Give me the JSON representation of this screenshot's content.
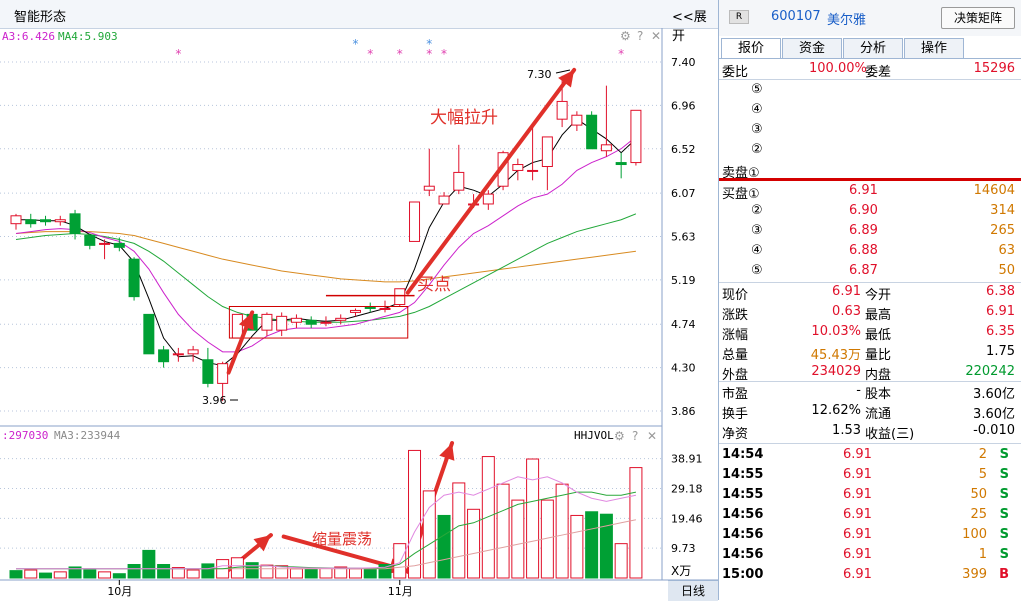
{
  "window": {
    "title": "智能形态",
    "expand_label": "<<展开"
  },
  "ma_labels": {
    "ma3": "A3:6.426",
    "ma4": "MA4:5.903",
    "vol1": ":297030",
    "vol2": "MA3:233944",
    "vol_name": "HHJVOL"
  },
  "annotations": {
    "surge": "大幅拉升",
    "buy": "买点",
    "shrink": "缩量震荡",
    "high_label": "7.30",
    "low_label": "3.96"
  },
  "colors": {
    "up": "#e0102a",
    "down": "#00a034",
    "ma_black": "#000000",
    "ma_magenta": "#cc22cc",
    "ma_green": "#22a83a",
    "ma_orange": "#d88a20",
    "vol_pink": "#e088e0",
    "vol_green": "#2aa83a"
  },
  "chart_data": [
    {
      "type": "candlestick",
      "title": "",
      "y_ticks": [
        "7.40",
        "6.96",
        "6.52",
        "6.07",
        "5.63",
        "5.19",
        "4.74",
        "4.30",
        "3.86"
      ],
      "x_ticks": [
        "10月",
        "11月"
      ],
      "ylim": [
        3.86,
        7.4
      ],
      "candles": [
        {
          "o": 5.76,
          "h": 5.86,
          "l": 5.7,
          "c": 5.84
        },
        {
          "o": 5.8,
          "h": 5.86,
          "l": 5.72,
          "c": 5.76
        },
        {
          "o": 5.8,
          "h": 5.84,
          "l": 5.74,
          "c": 5.78
        },
        {
          "o": 5.78,
          "h": 5.84,
          "l": 5.74,
          "c": 5.8
        },
        {
          "o": 5.86,
          "h": 5.9,
          "l": 5.6,
          "c": 5.66
        },
        {
          "o": 5.64,
          "h": 5.66,
          "l": 5.5,
          "c": 5.54
        },
        {
          "o": 5.56,
          "h": 5.6,
          "l": 5.4,
          "c": 5.56
        },
        {
          "o": 5.56,
          "h": 5.62,
          "l": 5.48,
          "c": 5.52
        },
        {
          "o": 5.4,
          "h": 5.42,
          "l": 4.98,
          "c": 5.02
        },
        {
          "o": 4.84,
          "h": 4.84,
          "l": 4.44,
          "c": 4.44
        },
        {
          "o": 4.48,
          "h": 4.52,
          "l": 4.3,
          "c": 4.36
        },
        {
          "o": 4.44,
          "h": 4.5,
          "l": 4.36,
          "c": 4.44
        },
        {
          "o": 4.44,
          "h": 4.52,
          "l": 4.36,
          "c": 4.48
        },
        {
          "o": 4.38,
          "h": 4.5,
          "l": 4.1,
          "c": 4.14
        },
        {
          "o": 4.14,
          "h": 4.36,
          "l": 3.96,
          "c": 4.34
        },
        {
          "o": 4.6,
          "h": 4.84,
          "l": 4.6,
          "c": 4.84
        },
        {
          "o": 4.84,
          "h": 4.88,
          "l": 4.68,
          "c": 4.68
        },
        {
          "o": 4.68,
          "h": 4.86,
          "l": 4.62,
          "c": 4.84
        },
        {
          "o": 4.68,
          "h": 4.86,
          "l": 4.62,
          "c": 4.82
        },
        {
          "o": 4.76,
          "h": 4.84,
          "l": 4.7,
          "c": 4.8
        },
        {
          "o": 4.78,
          "h": 4.82,
          "l": 4.7,
          "c": 4.74
        },
        {
          "o": 4.76,
          "h": 4.82,
          "l": 4.72,
          "c": 4.76
        },
        {
          "o": 4.78,
          "h": 4.84,
          "l": 4.74,
          "c": 4.8
        },
        {
          "o": 4.86,
          "h": 4.9,
          "l": 4.82,
          "c": 4.88
        },
        {
          "o": 4.92,
          "h": 4.96,
          "l": 4.86,
          "c": 4.9
        },
        {
          "o": 4.9,
          "h": 4.98,
          "l": 4.86,
          "c": 4.9
        },
        {
          "o": 4.94,
          "h": 5.1,
          "l": 4.92,
          "c": 5.1
        },
        {
          "o": 5.58,
          "h": 5.98,
          "l": 5.58,
          "c": 5.98
        },
        {
          "o": 6.1,
          "h": 6.52,
          "l": 6.04,
          "c": 6.14
        },
        {
          "o": 5.96,
          "h": 6.08,
          "l": 5.96,
          "c": 6.04
        },
        {
          "o": 6.1,
          "h": 6.56,
          "l": 6.06,
          "c": 6.28
        },
        {
          "o": 5.96,
          "h": 6.06,
          "l": 5.92,
          "c": 5.96
        },
        {
          "o": 5.96,
          "h": 6.1,
          "l": 5.9,
          "c": 6.06
        },
        {
          "o": 6.14,
          "h": 6.5,
          "l": 6.1,
          "c": 6.48
        },
        {
          "o": 6.3,
          "h": 6.42,
          "l": 6.2,
          "c": 6.36
        },
        {
          "o": 6.3,
          "h": 6.76,
          "l": 6.2,
          "c": 6.3
        },
        {
          "o": 6.34,
          "h": 6.64,
          "l": 6.1,
          "c": 6.64
        },
        {
          "o": 6.82,
          "h": 7.26,
          "l": 6.74,
          "c": 7.0
        },
        {
          "o": 6.76,
          "h": 6.9,
          "l": 6.7,
          "c": 6.86
        },
        {
          "o": 6.86,
          "h": 6.9,
          "l": 6.52,
          "c": 6.52
        },
        {
          "o": 6.5,
          "h": 7.16,
          "l": 6.44,
          "c": 6.56
        },
        {
          "o": 6.38,
          "h": 6.48,
          "l": 6.22,
          "c": 6.36
        },
        {
          "o": 6.38,
          "h": 6.91,
          "l": 6.35,
          "c": 6.91
        }
      ],
      "ma_black": [
        5.8,
        5.8,
        5.79,
        5.79,
        5.74,
        5.65,
        5.58,
        5.54,
        5.37,
        5.0,
        4.6,
        4.41,
        4.42,
        4.35,
        4.32,
        4.44,
        4.62,
        4.78,
        4.78,
        4.8,
        4.78,
        4.77,
        4.78,
        4.82,
        4.86,
        4.9,
        4.96,
        5.3,
        5.72,
        5.98,
        6.14,
        6.1,
        6.04,
        6.16,
        6.3,
        6.38,
        6.42,
        6.66,
        6.82,
        6.72,
        6.62,
        6.48,
        6.62
      ],
      "ma_magenta": [
        5.66,
        5.68,
        5.7,
        5.71,
        5.7,
        5.67,
        5.62,
        5.58,
        5.48,
        5.3,
        5.06,
        4.84,
        4.68,
        4.56,
        4.46,
        4.46,
        4.52,
        4.62,
        4.68,
        4.7,
        4.7,
        4.7,
        4.72,
        4.74,
        4.78,
        4.82,
        4.86,
        4.96,
        5.14,
        5.34,
        5.52,
        5.66,
        5.74,
        5.84,
        5.94,
        6.02,
        6.06,
        6.16,
        6.3,
        6.38,
        6.44,
        6.52,
        6.64
      ],
      "ma_green": [
        5.6,
        5.62,
        5.64,
        5.65,
        5.66,
        5.65,
        5.63,
        5.6,
        5.56,
        5.48,
        5.38,
        5.26,
        5.14,
        5.02,
        4.92,
        4.86,
        4.82,
        4.8,
        4.78,
        4.77,
        4.76,
        4.76,
        4.76,
        4.77,
        4.78,
        4.8,
        4.82,
        4.86,
        4.92,
        5.0,
        5.08,
        5.16,
        5.24,
        5.32,
        5.4,
        5.48,
        5.56,
        5.62,
        5.68,
        5.72,
        5.76,
        5.8,
        5.86
      ],
      "ma_orange": [
        5.66,
        5.67,
        5.68,
        5.68,
        5.68,
        5.68,
        5.67,
        5.66,
        5.64,
        5.6,
        5.56,
        5.52,
        5.48,
        5.44,
        5.4,
        5.37,
        5.34,
        5.31,
        5.28,
        5.26,
        5.24,
        5.22,
        5.2,
        5.19,
        5.18,
        5.17,
        5.17,
        5.18,
        5.2,
        5.22,
        5.24,
        5.26,
        5.28,
        5.3,
        5.32,
        5.34,
        5.36,
        5.38,
        5.4,
        5.42,
        5.44,
        5.46,
        5.48
      ]
    },
    {
      "type": "bar",
      "title": "",
      "y_ticks": [
        "38.91",
        "29.18",
        "19.46",
        "9.73"
      ],
      "ylim": [
        0,
        45
      ],
      "unit": "X万",
      "volumes": [
        {
          "v": 2.4,
          "u": false
        },
        {
          "v": 2.6,
          "u": true
        },
        {
          "v": 1.6,
          "u": false
        },
        {
          "v": 2.0,
          "u": true
        },
        {
          "v": 3.6,
          "u": false
        },
        {
          "v": 2.6,
          "u": false
        },
        {
          "v": 2.0,
          "u": true
        },
        {
          "v": 1.4,
          "u": false
        },
        {
          "v": 4.4,
          "u": false
        },
        {
          "v": 9.0,
          "u": false
        },
        {
          "v": 4.4,
          "u": false
        },
        {
          "v": 3.4,
          "u": true
        },
        {
          "v": 2.6,
          "u": true
        },
        {
          "v": 4.6,
          "u": false
        },
        {
          "v": 6.0,
          "u": true
        },
        {
          "v": 6.6,
          "u": true
        },
        {
          "v": 5.0,
          "u": false
        },
        {
          "v": 4.2,
          "u": true
        },
        {
          "v": 4.0,
          "u": true
        },
        {
          "v": 3.0,
          "u": true
        },
        {
          "v": 2.8,
          "u": false
        },
        {
          "v": 3.2,
          "u": true
        },
        {
          "v": 3.6,
          "u": true
        },
        {
          "v": 3.0,
          "u": true
        },
        {
          "v": 3.0,
          "u": false
        },
        {
          "v": 4.4,
          "u": false
        },
        {
          "v": 11.2,
          "u": true
        },
        {
          "v": 41.6,
          "u": true
        },
        {
          "v": 28.4,
          "u": true
        },
        {
          "v": 20.4,
          "u": false
        },
        {
          "v": 31.0,
          "u": true
        },
        {
          "v": 22.4,
          "u": true
        },
        {
          "v": 39.6,
          "u": true
        },
        {
          "v": 30.6,
          "u": true
        },
        {
          "v": 25.4,
          "u": true
        },
        {
          "v": 38.8,
          "u": true
        },
        {
          "v": 25.4,
          "u": true
        },
        {
          "v": 30.6,
          "u": true
        },
        {
          "v": 20.4,
          "u": true
        },
        {
          "v": 21.6,
          "u": false
        },
        {
          "v": 20.8,
          "u": false
        },
        {
          "v": 11.2,
          "u": true
        },
        {
          "v": 36.0,
          "u": true
        }
      ],
      "vol_ma_pink": [
        3,
        3,
        3,
        3,
        3,
        3,
        3,
        3,
        3,
        3,
        3,
        3,
        3,
        3,
        4,
        4,
        4,
        4,
        3.6,
        3.4,
        3.2,
        3.2,
        3.2,
        3.2,
        3.3,
        3.5,
        5,
        15,
        23,
        27,
        28,
        27,
        29,
        31,
        33,
        32,
        33,
        31,
        28,
        26,
        25,
        26,
        27
      ],
      "vol_ma_green": [
        3,
        3,
        3,
        3,
        3,
        3,
        3,
        3,
        3,
        3,
        3,
        3,
        3,
        3,
        3,
        3.5,
        3.8,
        4,
        3.8,
        3.6,
        3.4,
        3.3,
        3.2,
        3.2,
        3.2,
        3.3,
        4.5,
        8,
        11,
        14,
        17,
        18,
        20,
        22,
        24,
        25,
        26,
        27,
        28,
        28,
        27,
        27,
        28
      ],
      "vol_ma_pinklong": [
        3,
        3,
        3,
        3,
        3,
        3,
        3,
        3,
        3,
        3,
        3,
        3,
        3,
        3,
        3,
        3,
        3,
        3,
        3,
        3,
        3,
        3,
        3,
        3,
        3,
        3,
        3.5,
        4,
        5,
        6,
        7,
        8,
        9,
        10,
        11,
        12,
        13,
        14,
        15,
        16,
        17,
        18,
        19
      ]
    }
  ],
  "quote": {
    "code": "600107",
    "name": "美尔雅",
    "badge": "R",
    "decision_btn": "决策矩阵",
    "tabs": [
      "报价",
      "资金",
      "分析",
      "操作"
    ],
    "weibi_label": "委比",
    "weibi_value": "100.00%",
    "weicha_label": "委差",
    "weicha_value": "15296",
    "sell_rows": [
      {
        "label": "⑤",
        "price": "",
        "vol": ""
      },
      {
        "label": "④",
        "price": "",
        "vol": ""
      },
      {
        "label": "③",
        "price": "",
        "vol": ""
      },
      {
        "label": "②",
        "price": "",
        "vol": ""
      },
      {
        "label": "卖盘①",
        "price": "",
        "vol": ""
      }
    ],
    "buy_rows": [
      {
        "label": "买盘①",
        "price": "6.91",
        "vol": "14604"
      },
      {
        "label": "②",
        "price": "6.90",
        "vol": "314"
      },
      {
        "label": "③",
        "price": "6.89",
        "vol": "265"
      },
      {
        "label": "④",
        "price": "6.88",
        "vol": "63"
      },
      {
        "label": "⑤",
        "price": "6.87",
        "vol": "50"
      }
    ],
    "stats1": [
      {
        "l1": "现价",
        "v1": "6.91",
        "c1": "red",
        "l2": "今开",
        "v2": "6.38",
        "c2": "red"
      },
      {
        "l1": "涨跌",
        "v1": "0.63",
        "c1": "red",
        "l2": "最高",
        "v2": "6.91",
        "c2": "red"
      },
      {
        "l1": "涨幅",
        "v1": "10.03%",
        "c1": "red",
        "l2": "最低",
        "v2": "6.35",
        "c2": "red"
      },
      {
        "l1": "总量",
        "v1": "45.43万",
        "c1": "orange",
        "l2": "量比",
        "v2": "1.75",
        "c2": "black"
      },
      {
        "l1": "外盘",
        "v1": "234029",
        "c1": "red",
        "l2": "内盘",
        "v2": "220242",
        "c2": "green"
      }
    ],
    "stats2": [
      {
        "l1": "市盈",
        "v1": "-",
        "c1": "black",
        "l2": "股本",
        "v2": "3.60亿",
        "c2": "black"
      },
      {
        "l1": "换手",
        "v1": "12.62%",
        "c1": "black",
        "l2": "流通",
        "v2": "3.60亿",
        "c2": "black"
      },
      {
        "l1": "净资",
        "v1": "1.53",
        "c1": "black",
        "l2": "收益(三)",
        "v2": "-0.010",
        "c2": "black"
      }
    ],
    "ticks": [
      {
        "time": "14:54",
        "price": "6.91",
        "vol": "2",
        "side": "S"
      },
      {
        "time": "14:55",
        "price": "6.91",
        "vol": "5",
        "side": "S"
      },
      {
        "time": "14:55",
        "price": "6.91",
        "vol": "50",
        "side": "S"
      },
      {
        "time": "14:56",
        "price": "6.91",
        "vol": "25",
        "side": "S"
      },
      {
        "time": "14:56",
        "price": "6.91",
        "vol": "100",
        "side": "S"
      },
      {
        "time": "14:56",
        "price": "6.91",
        "vol": "1",
        "side": "S"
      },
      {
        "time": "15:00",
        "price": "6.91",
        "vol": "399",
        "side": "B"
      }
    ],
    "daily_tab": "日线"
  }
}
